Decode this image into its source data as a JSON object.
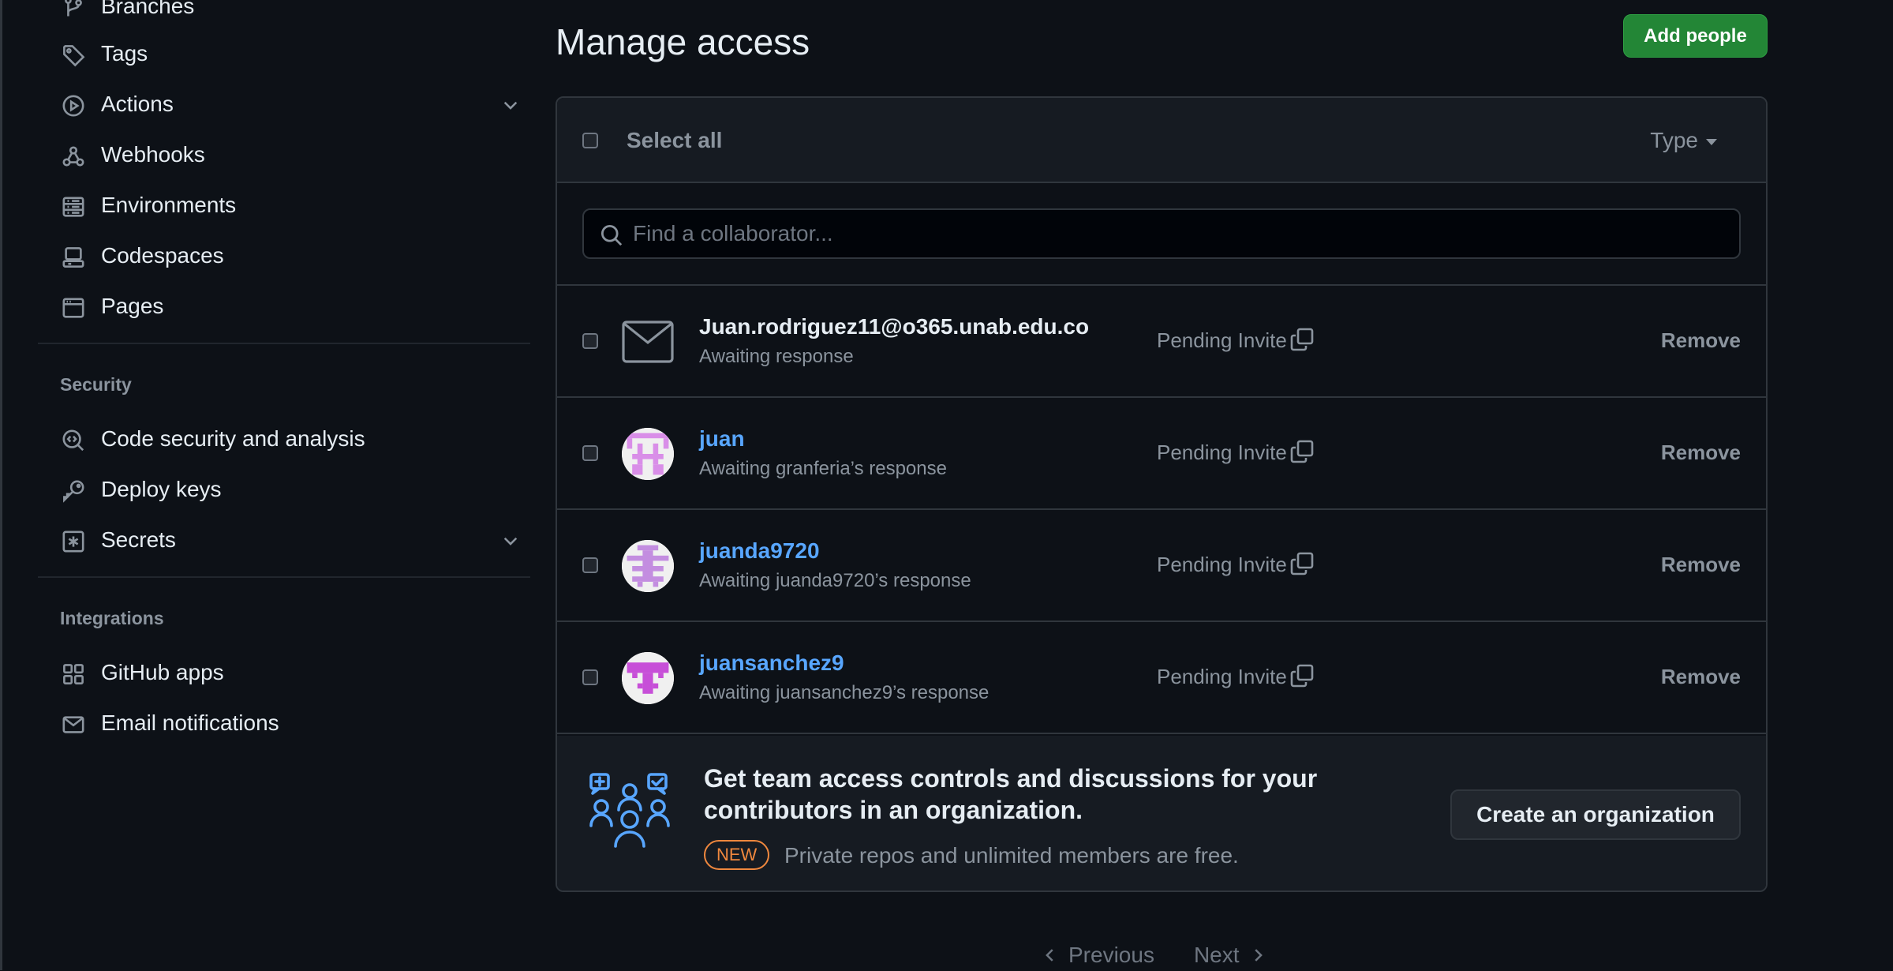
{
  "sidebar": {
    "items": [
      {
        "label": "Branches",
        "icon": "branch-icon"
      },
      {
        "label": "Tags",
        "icon": "tag-icon"
      },
      {
        "label": "Actions",
        "icon": "play-icon"
      },
      {
        "label": "Webhooks",
        "icon": "webhook-icon"
      },
      {
        "label": "Environments",
        "icon": "server-icon"
      },
      {
        "label": "Codespaces",
        "icon": "codespaces-icon"
      },
      {
        "label": "Pages",
        "icon": "browser-icon"
      }
    ],
    "security": {
      "title": "Security",
      "items": [
        {
          "label": "Code security and analysis",
          "icon": "codescan-icon"
        },
        {
          "label": "Deploy keys",
          "icon": "key-icon"
        },
        {
          "label": "Secrets",
          "icon": "asterisk-icon"
        }
      ]
    },
    "integrations": {
      "title": "Integrations",
      "items": [
        {
          "label": "GitHub apps",
          "icon": "apps-icon"
        },
        {
          "label": "Email notifications",
          "icon": "mail-icon"
        }
      ]
    }
  },
  "main": {
    "title": "Manage access",
    "add_button": "Add people",
    "select_all": "Select all",
    "type_filter": "Type",
    "search": {
      "placeholder": "Find a collaborator..."
    },
    "rows": [
      {
        "name": "Juan.rodriguez11@o365.unab.edu.co",
        "sub": "Awaiting response",
        "status": "Pending Invite",
        "action": "Remove"
      },
      {
        "name": "juan",
        "sub": "Awaiting granferia’s response",
        "status": "Pending Invite",
        "action": "Remove"
      },
      {
        "name": "juanda9720",
        "sub": "Awaiting juanda9720’s response",
        "status": "Pending Invite",
        "action": "Remove"
      },
      {
        "name": "juansanchez9",
        "sub": "Awaiting juansanchez9’s response",
        "status": "Pending Invite",
        "action": "Remove"
      }
    ],
    "promo": {
      "headline": "Get team access controls and discussions for your contributors in an organization.",
      "badge": "NEW",
      "tagline": "Private repos and unlimited members are free.",
      "button": "Create an organization"
    },
    "pagination": {
      "previous": "Previous",
      "next": "Next"
    }
  },
  "colors": {
    "background": "#0d1117",
    "accent_green": "#238636",
    "link_blue": "#58a6ff",
    "badge_orange": "#f0883e",
    "avatar_purple": "#c38de0"
  }
}
